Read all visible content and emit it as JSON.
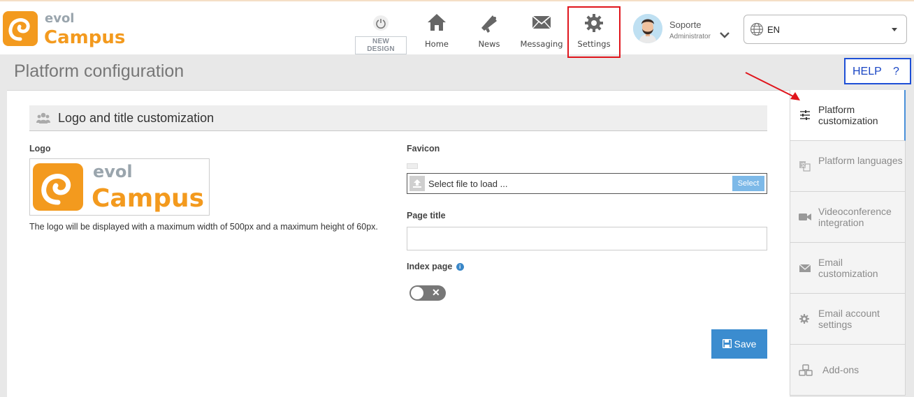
{
  "brand": {
    "name_top": "evol",
    "name_bottom": "Campus",
    "accent": "#f39a1e",
    "grey": "#9aa5ad"
  },
  "nav": {
    "new_design": {
      "prefix": "NEW",
      "label": "DESIGN"
    },
    "items": [
      {
        "label": "Home",
        "icon": "home-icon"
      },
      {
        "label": "News",
        "icon": "megaphone-icon"
      },
      {
        "label": "Messaging",
        "icon": "envelope-icon"
      },
      {
        "label": "Settings",
        "icon": "gear-icon"
      }
    ]
  },
  "user": {
    "name": "Soporte",
    "role": "Administrator"
  },
  "language": {
    "selected": "EN"
  },
  "page": {
    "title": "Platform configuration"
  },
  "help": {
    "label": "HELP",
    "symbol": "?"
  },
  "section": {
    "title": "Logo and title customization"
  },
  "form": {
    "logo_label": "Logo",
    "logo_help": "The logo will be displayed with a maximum width of 500px and a maximum height of 60px.",
    "favicon_label": "Favicon",
    "file_placeholder": "Select file to load ...",
    "select_button": "Select",
    "page_title_label": "Page title",
    "page_title_value": "",
    "index_page_label": "Index page",
    "index_page_enabled": false,
    "save_button": "Save"
  },
  "side_tabs": [
    {
      "label": "Platform customization",
      "icon": "sliders-icon",
      "active": true
    },
    {
      "label": "Platform languages",
      "icon": "translate-icon",
      "active": false
    },
    {
      "label": "Videoconference integration",
      "icon": "video-camera-icon",
      "active": false
    },
    {
      "label": "Email customization",
      "icon": "envelope-icon",
      "active": false
    },
    {
      "label": "Email account settings",
      "icon": "gear-icon",
      "active": false
    },
    {
      "label": "Add-ons",
      "icon": "cubes-icon",
      "active": false
    }
  ],
  "colors": {
    "highlight_red": "#e0151c",
    "help_blue": "#1e4fd6",
    "primary": "#3b8ccf"
  }
}
